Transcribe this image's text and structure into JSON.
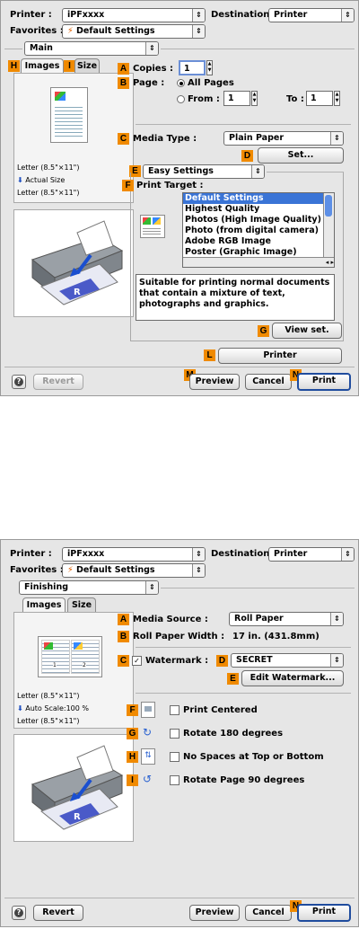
{
  "dialog1": {
    "printer_label": "Printer :",
    "printer_value": "iPFxxxx",
    "destination_label": "Destination :",
    "destination_value": "Printer",
    "favorites_label": "Favorites :",
    "favorites_value": "Default Settings",
    "panel_value": "Main",
    "tabs": [
      "Images",
      "Size"
    ],
    "badges": {
      "H": "H",
      "I": "I",
      "A": "A",
      "B": "B",
      "C": "C",
      "D": "D",
      "E": "E",
      "F": "F",
      "G": "G",
      "L": "L",
      "M": "M",
      "N": "N"
    },
    "copies_label": "Copies :",
    "copies_value": "1",
    "page_label": "Page :",
    "all_pages": "All Pages",
    "from_label": "From :",
    "from_value": "1",
    "to_label": "To :",
    "to_value": "1",
    "paper_info": [
      "Letter (8.5\"×11\")",
      "Actual Size",
      "Letter (8.5\"×11\")"
    ],
    "media_type_label": "Media Type :",
    "media_type_value": "Plain Paper",
    "set_button": "Set...",
    "mode_value": "Easy Settings",
    "print_target_label": "Print Target :",
    "targets": [
      "Default Settings",
      "Highest Quality",
      "Photos (High Image Quality)",
      "Photo (from digital camera)",
      "Adobe RGB Image",
      "Poster (Graphic Image)"
    ],
    "description": "Suitable for printing normal documents\nthat contain a mixture of text,\nphotographs and graphics.",
    "view_set_button": "View set.",
    "printer_button": "Printer",
    "revert_button": "Revert",
    "preview_button": "Preview",
    "cancel_button": "Cancel",
    "print_button": "Print"
  },
  "dialog2": {
    "printer_label": "Printer :",
    "printer_value": "iPFxxxx",
    "destination_label": "Destination :",
    "destination_value": "Printer",
    "favorites_label": "Favorites :",
    "favorites_value": "Default Settings",
    "panel_value": "Finishing",
    "tabs": [
      "Images",
      "Size"
    ],
    "badges": {
      "A": "A",
      "B": "B",
      "C": "C",
      "D": "D",
      "E": "E",
      "F": "F",
      "G": "G",
      "H": "H",
      "I": "I",
      "N": "N"
    },
    "media_source_label": "Media Source :",
    "media_source_value": "Roll Paper",
    "roll_width_label": "Roll Paper Width :",
    "roll_width_value": "17 in. (431.8mm)",
    "watermark_label": "Watermark :",
    "watermark_value": "SECRET",
    "edit_watermark_button": "Edit Watermark...",
    "paper_info": [
      "Letter (8.5\"×11\")",
      "Auto Scale:100 %",
      "Letter (8.5\"×11\")"
    ],
    "print_centered": "Print Centered",
    "rotate_180": "Rotate 180 degrees",
    "no_spaces": "No Spaces at Top or Bottom",
    "rotate_90": "Rotate Page 90 degrees",
    "revert_button": "Revert",
    "preview_button": "Preview",
    "cancel_button": "Cancel",
    "print_button": "Print"
  },
  "colors": {
    "badge": "#f08a00",
    "selection": "#3a74d6",
    "dialog_bg": "#e6e6e6",
    "default_button_border": "#1f4c9e"
  }
}
